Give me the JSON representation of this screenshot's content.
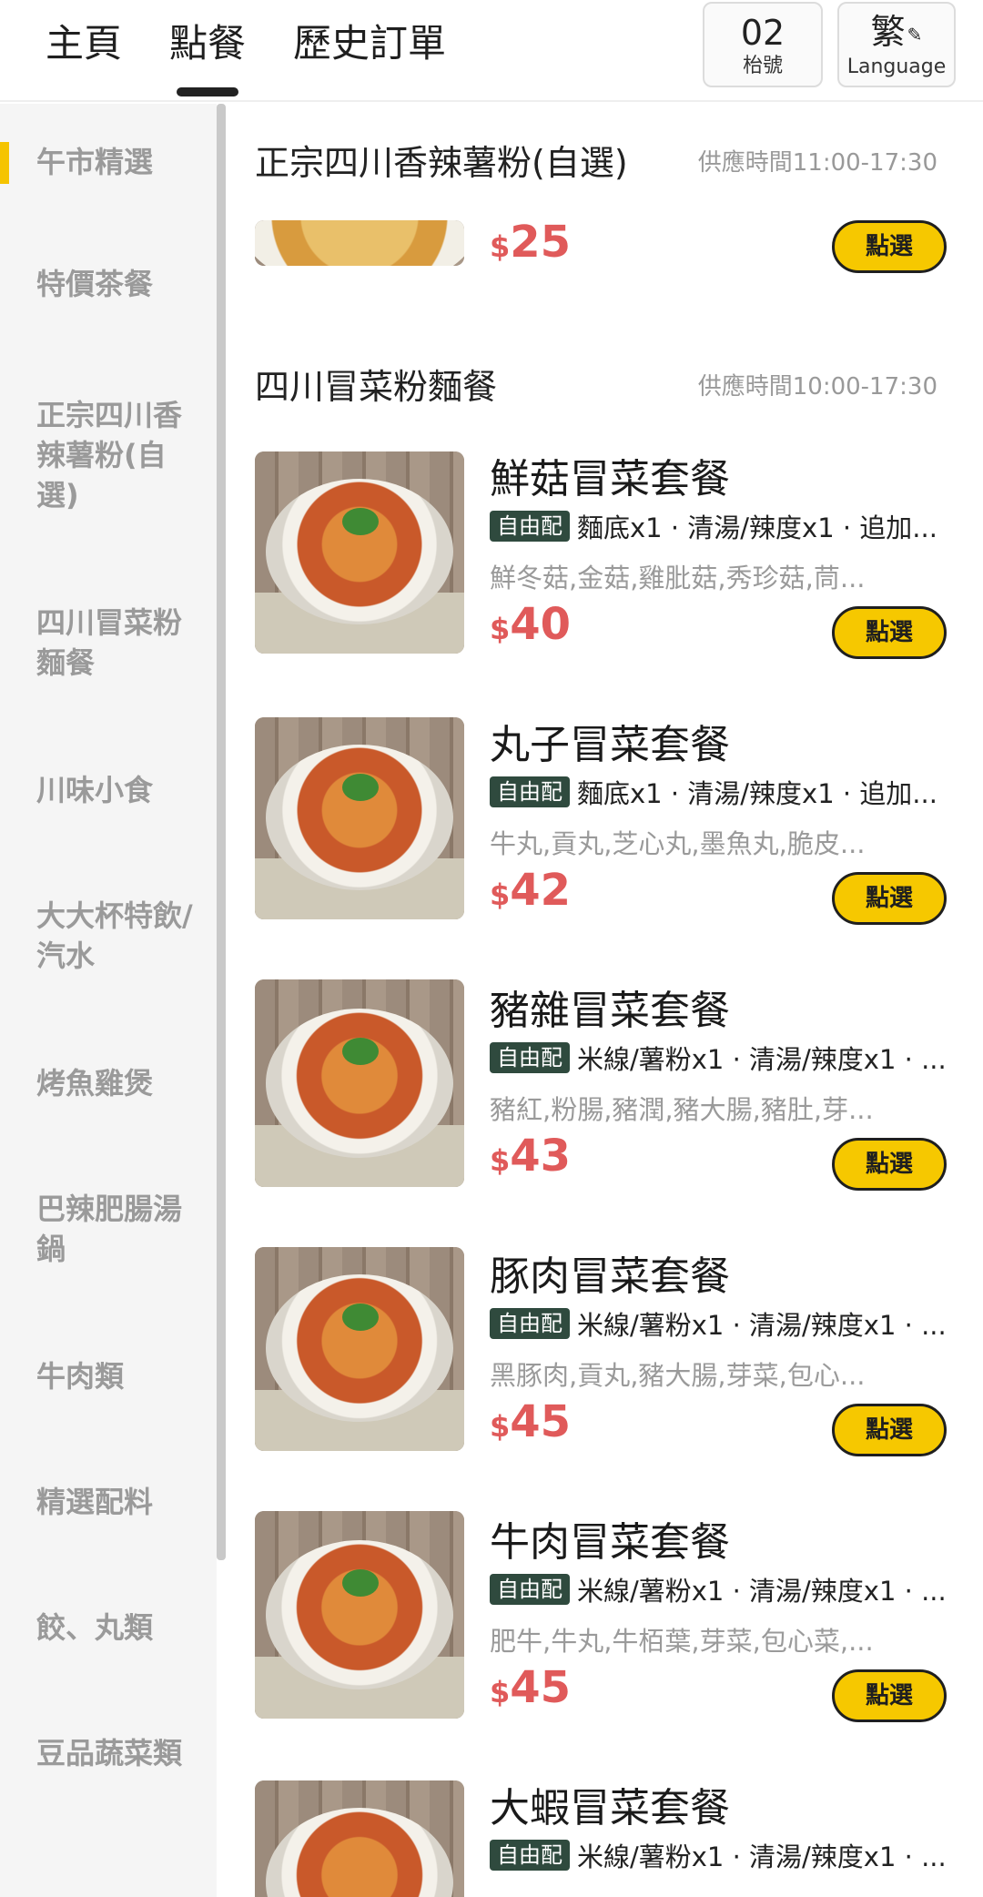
{
  "header": {
    "tabs": [
      {
        "label": "主頁"
      },
      {
        "label": "點餐",
        "active": true
      },
      {
        "label": "歷史訂單"
      }
    ],
    "table_number": "02",
    "table_label": "枱號",
    "language_char": "繁",
    "language_label": "Language"
  },
  "sidebar": {
    "items": [
      {
        "label": "午市精選",
        "active": true
      },
      {
        "label": "特價茶餐"
      },
      {
        "label": "正宗四川香辣薯粉(自選)"
      },
      {
        "label": "四川冒菜粉麵餐"
      },
      {
        "label": "川味小食"
      },
      {
        "label": "大大杯特飲/汽水"
      },
      {
        "label": "烤魚雞煲"
      },
      {
        "label": "巴辣肥腸湯鍋"
      },
      {
        "label": "牛肉類"
      },
      {
        "label": "精選配料"
      },
      {
        "label": "餃、丸類"
      },
      {
        "label": "豆品蔬菜類"
      }
    ]
  },
  "sections": [
    {
      "title": "正宗四川香辣薯粉(自選)",
      "time": "供應時間11:00-17:30",
      "partial_item": {
        "currency": "$",
        "price": "25",
        "button": "點選"
      }
    },
    {
      "title": "四川冒菜粉麵餐",
      "time": "供應時間10:00-17:30",
      "items": [
        {
          "name": "鮮菇冒菜套餐",
          "tag": "自由配",
          "options": "麵底x1 · 清湯/辣度x1 · 追加...",
          "ingredients": "鮮冬菇,金菇,雞肶菇,秀珍菇,茼...",
          "currency": "$",
          "price": "40",
          "button": "點選"
        },
        {
          "name": "丸子冒菜套餐",
          "tag": "自由配",
          "options": "麵底x1 · 清湯/辣度x1 · 追加...",
          "ingredients": "牛丸,貢丸,芝心丸,墨魚丸,脆皮...",
          "currency": "$",
          "price": "42",
          "button": "點選"
        },
        {
          "name": "豬雜冒菜套餐",
          "tag": "自由配",
          "options": "米線/薯粉x1 · 清湯/辣度x1 · ...",
          "ingredients": "豬紅,粉腸,豬潤,豬大腸,豬肚,芽...",
          "currency": "$",
          "price": "43",
          "button": "點選"
        },
        {
          "name": "豚肉冒菜套餐",
          "tag": "自由配",
          "options": "米線/薯粉x1 · 清湯/辣度x1 · ...",
          "ingredients": "黑豚肉,貢丸,豬大腸,芽菜,包心...",
          "currency": "$",
          "price": "45",
          "button": "點選"
        },
        {
          "name": "牛肉冒菜套餐",
          "tag": "自由配",
          "options": "米線/薯粉x1 · 清湯/辣度x1 · ...",
          "ingredients": "肥牛,牛丸,牛栢葉,芽菜,包心菜,...",
          "currency": "$",
          "price": "45",
          "button": "點選"
        },
        {
          "name": "大蝦冒菜套餐",
          "tag": "自由配",
          "options": "米線/薯粉x1 · 清湯/辣度x1 · ..."
        }
      ]
    }
  ],
  "colors": {
    "accent": "#f6c800",
    "price": "#e05a5a",
    "tag_bg": "#2f4a3e"
  }
}
